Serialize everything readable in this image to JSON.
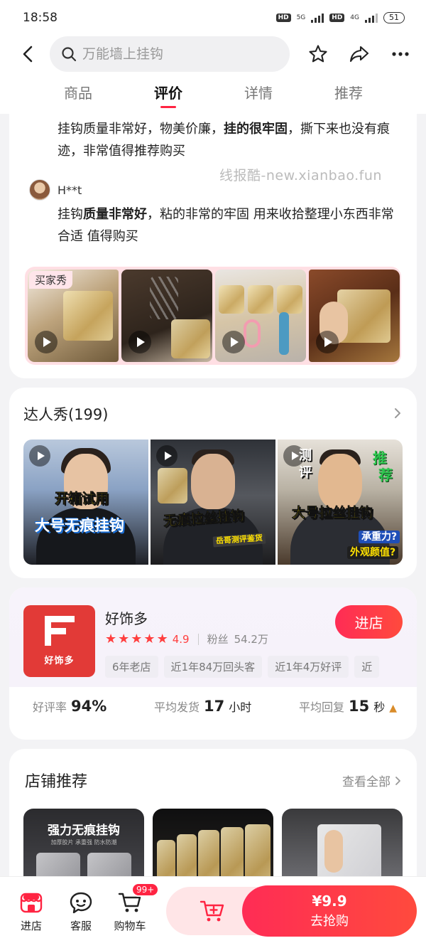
{
  "status_bar": {
    "time": "18:58",
    "hd1": "HD",
    "net1": "5G",
    "hd2": "HD",
    "net2": "4G",
    "battery": "51"
  },
  "header": {
    "search_placeholder": "万能墙上挂钩",
    "icons": [
      "back-icon",
      "search-icon",
      "star-icon",
      "share-icon",
      "more-icon"
    ]
  },
  "tabs": [
    {
      "label": "商品",
      "active": false
    },
    {
      "label": "评价",
      "active": true
    },
    {
      "label": "详情",
      "active": false
    },
    {
      "label": "推荐",
      "active": false
    }
  ],
  "reviews": {
    "first": {
      "parts": [
        "挂钩质量非常好，物美价廉，",
        "挂的很牢固",
        "，撕下来也没有痕迹，非常值得推荐购买"
      ]
    },
    "watermark": "线报酷-new.xianbao.fun",
    "second": {
      "user": "H**t",
      "parts": [
        "挂钩",
        "质量非常好",
        "，粘的非常的牢固 用来收拾整理小东西非常合适 值得购买"
      ]
    },
    "photo_tag": "买家秀"
  },
  "talent": {
    "title": "达人秀(199)",
    "videos": [
      {
        "cap1": "开箱试用",
        "cap2": "大号无痕挂钩"
      },
      {
        "cap1": "无痕拉丝挂钩",
        "tag": "岳哥测评鉴货"
      },
      {
        "side1": "测",
        "side2": "评",
        "green1": "推",
        "green2": "荐",
        "cap1": "大号拉丝挂钩",
        "q1": "承重力?",
        "q2": "外观颜值?"
      }
    ]
  },
  "shop": {
    "logo_text": "好饰多",
    "name": "好饰多",
    "rating": "4.9",
    "stars": 5,
    "fans_label": "粉丝",
    "fans_value": "54.2万",
    "enter_label": "进店",
    "tags": [
      "6年老店",
      "近1年84万回头客",
      "近1年4万好评",
      "近"
    ],
    "stats": [
      {
        "label": "好评率",
        "value": "94%",
        "unit": ""
      },
      {
        "label": "平均发货",
        "value": "17",
        "unit": "小时"
      },
      {
        "label": "平均回复",
        "value": "15",
        "unit": "秒"
      }
    ]
  },
  "recommend": {
    "title": "店铺推荐",
    "see_all": "查看全部",
    "products": [
      {
        "caption": "强力无痕挂钩",
        "sub": "加厚胶片  承重强  防水防潮"
      },
      {
        "caption": ""
      },
      {
        "caption": ""
      }
    ]
  },
  "bottom_bar": {
    "store_label": "进店",
    "service_label": "客服",
    "cart_label": "购物车",
    "cart_badge": "99+",
    "price": "¥9.9",
    "buy_label": "去抢购"
  },
  "colors": {
    "accent": "#ff2442",
    "buy_gradient_start": "#ff2c55",
    "buy_gradient_end": "#ff4a3d",
    "shop_logo": "#e23a37"
  }
}
